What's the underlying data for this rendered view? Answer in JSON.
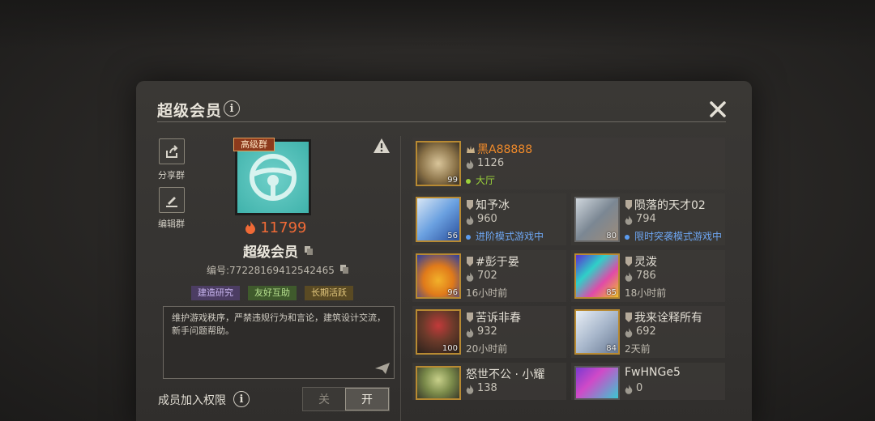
{
  "header": {
    "title": "超级会员"
  },
  "tools": {
    "share_label": "分享群",
    "edit_label": "编辑群"
  },
  "group": {
    "rank_badge": "高级群",
    "score": "11799",
    "name": "超级会员",
    "id_text": "编号:77228169412542465",
    "tags": [
      {
        "label": "建造研究",
        "bg": "#4c3d63",
        "color": "#c9b5f0"
      },
      {
        "label": "友好互助",
        "bg": "#3f5a2c",
        "color": "#b7e08f"
      },
      {
        "label": "长期活跃",
        "bg": "#5a4a23",
        "color": "#e0c57c"
      }
    ],
    "description": "维护游戏秩序，严禁违规行为和言论，建筑设计交流，新手问题帮助。"
  },
  "permissions": {
    "label": "成员加入权限",
    "off_label": "关",
    "on_label": "开",
    "state": "开"
  },
  "members": [
    {
      "name": "黑A88888",
      "points": "1126",
      "status": "大厅",
      "level": "99",
      "leader": true,
      "status_color": "#9ad13a"
    },
    {
      "name": "知予冰",
      "points": "960",
      "status": "进阶模式游戏中",
      "level": "56",
      "status_color": "#5b9cf0"
    },
    {
      "name": "陨落的天才02",
      "points": "794",
      "status": "限时突袭模式游戏中",
      "level": "80",
      "status_color": "#5b9cf0"
    },
    {
      "name": "#彭于晏",
      "points": "702",
      "status": "16小时前",
      "level": "96"
    },
    {
      "name": "灵泼",
      "points": "786",
      "status": "18小时前",
      "level": "85"
    },
    {
      "name": "苦诉非春",
      "points": "932",
      "status": "20小时前",
      "level": "100"
    },
    {
      "name": "我来诠释所有",
      "points": "692",
      "status": "2天前",
      "level": "84"
    },
    {
      "name": "怒世不公 · 小耀",
      "points": "138",
      "status": "",
      "level": ""
    },
    {
      "name": "FwHNGe5",
      "points": "0",
      "status": "",
      "level": ""
    }
  ],
  "colors": {
    "accent_orange": "#f06a36",
    "leader_name": "#f08a2a"
  }
}
